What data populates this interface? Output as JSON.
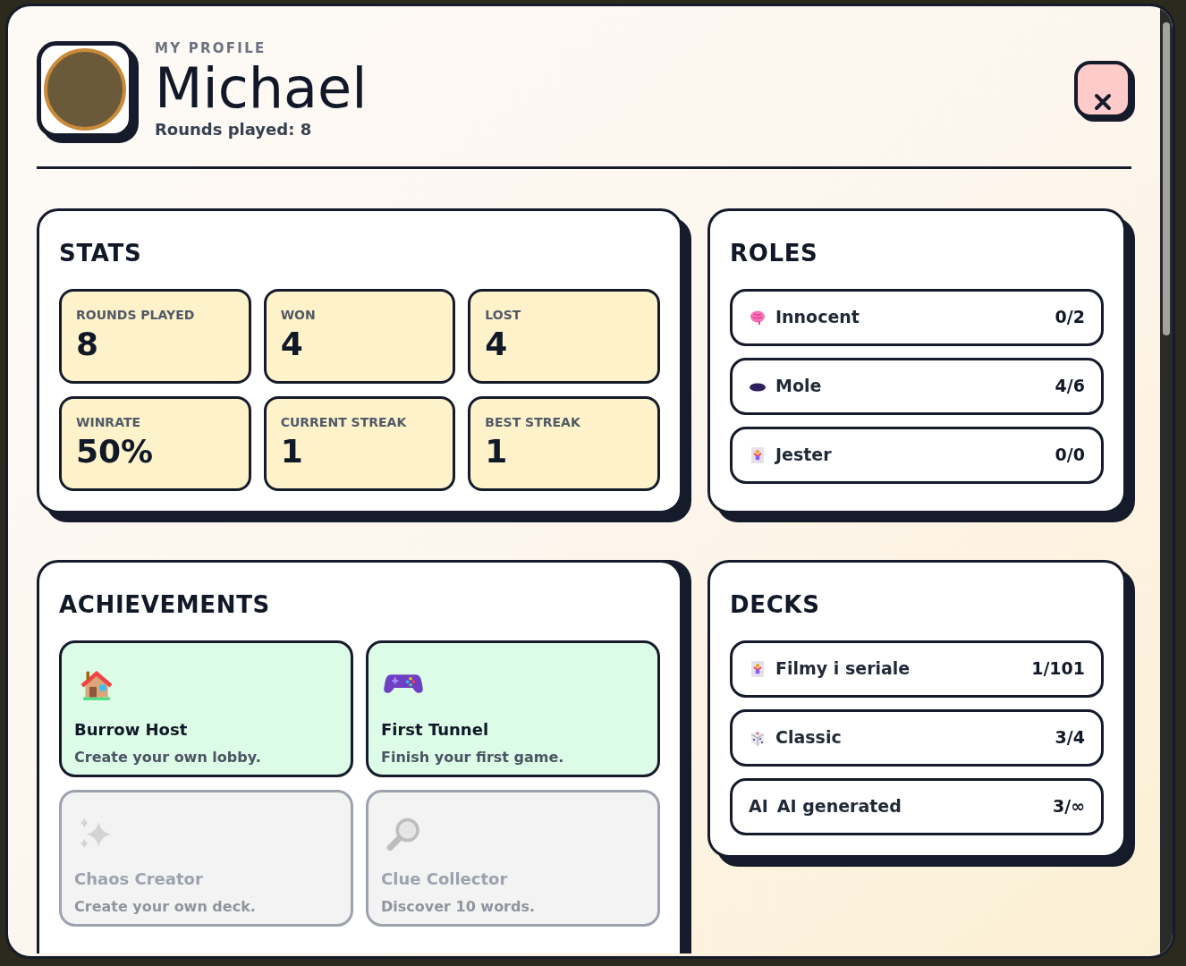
{
  "header": {
    "eyebrow": "MY PROFILE",
    "name": "Michael",
    "subtitle": "Rounds played: 8"
  },
  "stats": {
    "title": "STATS",
    "tiles": [
      {
        "label": "ROUNDS PLAYED",
        "value": "8"
      },
      {
        "label": "WON",
        "value": "4"
      },
      {
        "label": "LOST",
        "value": "4"
      },
      {
        "label": "WINRATE",
        "value": "50%"
      },
      {
        "label": "CURRENT STREAK",
        "value": "1"
      },
      {
        "label": "BEST STREAK",
        "value": "1"
      }
    ]
  },
  "roles": {
    "title": "ROLES",
    "items": [
      {
        "kind": "brain",
        "name": "Innocent",
        "count": "0/2"
      },
      {
        "kind": "hole",
        "name": "Mole",
        "count": "4/6"
      },
      {
        "kind": "jester",
        "name": "Jester",
        "count": "0/0"
      }
    ]
  },
  "achievements": {
    "title": "ACHIEVEMENTS",
    "items": [
      {
        "kind": "house",
        "title": "Burrow Host",
        "description": "Create your own lobby.",
        "unlocked": true
      },
      {
        "kind": "gamepad",
        "title": "First Tunnel",
        "description": "Finish your first game.",
        "unlocked": true
      },
      {
        "kind": "sparkles",
        "title": "Chaos Creator",
        "description": "Create your own deck.",
        "unlocked": false
      },
      {
        "kind": "magnifier",
        "title": "Clue Collector",
        "description": "Discover 10 words.",
        "unlocked": false
      }
    ]
  },
  "decks": {
    "title": "DECKS",
    "items": [
      {
        "kind": "jester",
        "name": "Filmy i seriale",
        "count": "1/101"
      },
      {
        "kind": "dice",
        "name": "Classic",
        "count": "3/4"
      },
      {
        "kind": "text",
        "badge": "AI",
        "name": "AI generated",
        "count": "3/∞"
      }
    ]
  }
}
